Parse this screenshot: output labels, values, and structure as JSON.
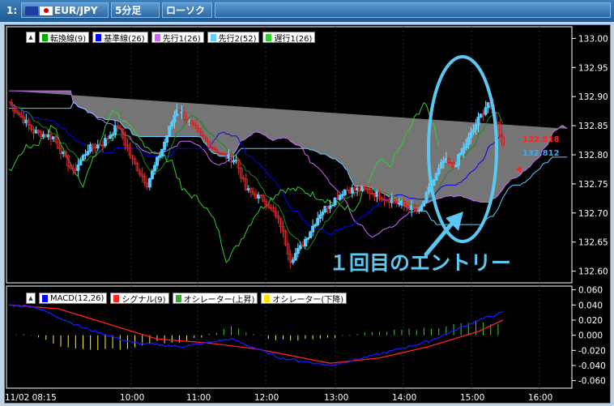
{
  "toolbar": {
    "slot": "1:",
    "pair": "EUR/JPY",
    "timeframe": "5分足",
    "chart_style": "ローソク"
  },
  "main_legend": [
    "転換線(9)",
    "基準線(26)",
    "先行1(26)",
    "先行2(52)",
    "遅行1(26)"
  ],
  "sub_legend": [
    "MACD(12,26)",
    "シグナル(9)",
    "オシレーター(上昇)",
    "オシレーター(下降)"
  ],
  "colors": {
    "tenkan": "#00ff00",
    "kijun": "#0000ff",
    "senkou1": "#cc66ff",
    "senkou2": "#66ccff",
    "chikou": "#33cc33",
    "up_candle": "#55ccff",
    "down_candle": "#cc2222",
    "macd": "#1a1aff",
    "signal": "#ff2222",
    "osc_up": "#33cc33",
    "osc_down": "#ffee44",
    "annotation": "#5ac8f0"
  },
  "annotation_text": "１回目のエントリー",
  "chart_data": [
    {
      "type": "candlestick",
      "ylim": [
        132.58,
        133.02
      ],
      "y_ticks": [
        "133.00",
        "132.95",
        "132.90",
        "132.85",
        "132.80",
        "132.75",
        "132.70",
        "132.65",
        "132.60"
      ],
      "price_labels": {
        "ask": "132.818",
        "bid": "132.812"
      },
      "legend_placement": "top-left"
    },
    {
      "type": "line",
      "series_names": [
        "MACD(12,26)",
        "シグナル(9)",
        "オシレーター(上昇)",
        "オシレーター(下降)"
      ],
      "ylim": [
        -0.07,
        0.065
      ],
      "y_ticks": [
        "0.060",
        "0.040",
        "0.020",
        "0.000",
        "-0.020",
        "-0.040",
        "-0.060"
      ],
      "x_ticks": [
        "11/02 08:15",
        "10:00",
        "11:00",
        "12:00",
        "13:00",
        "14:00",
        "15:00",
        "16:00"
      ],
      "legend_placement": "top-left"
    }
  ]
}
